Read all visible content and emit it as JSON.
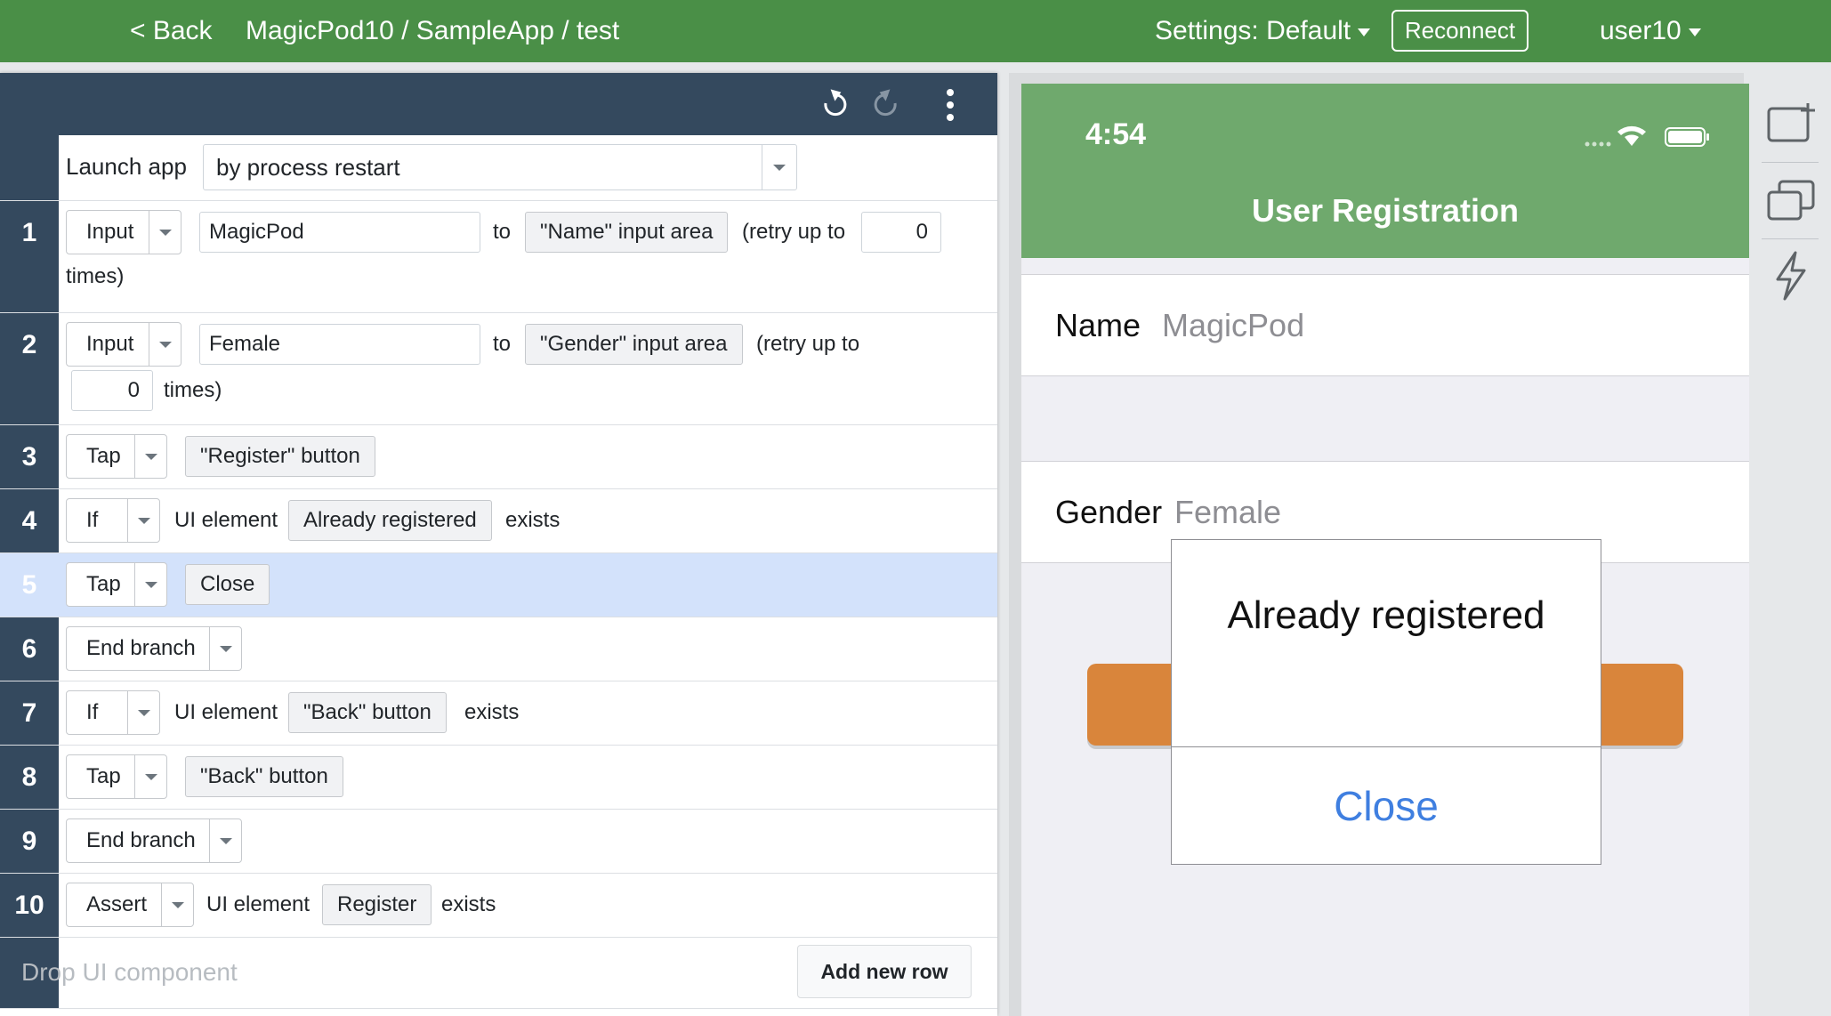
{
  "header": {
    "back_label": "< Back",
    "breadcrumb": "MagicPod10 / SampleApp / test",
    "settings_label": "Settings: Default",
    "reconnect_label": "Reconnect",
    "user_label": "user10"
  },
  "toolbar": {
    "icons": [
      "undo-icon",
      "redo-icon",
      "more-vertical-icon"
    ]
  },
  "launch": {
    "label": "Launch app",
    "value": "by process restart"
  },
  "steps": [
    {
      "num": "1",
      "command": "Input",
      "value": "MagicPod",
      "to": "to",
      "target": "\"Name\" input area",
      "retry_prefix": "(retry up to",
      "retry_count": "0",
      "retry_suffix": "times)"
    },
    {
      "num": "2",
      "command": "Input",
      "value": "Female",
      "to": "to",
      "target": "\"Gender\" input area",
      "retry_prefix": "(retry up to",
      "retry_count": "0",
      "retry_suffix": "times)"
    },
    {
      "num": "3",
      "command": "Tap",
      "target": "\"Register\" button"
    },
    {
      "num": "4",
      "command": "If",
      "prefix": "UI element",
      "target": "Already registered",
      "suffix": "exists"
    },
    {
      "num": "5",
      "command": "Tap",
      "target": "Close",
      "selected": true
    },
    {
      "num": "6",
      "command": "End branch"
    },
    {
      "num": "7",
      "command": "If",
      "prefix": "UI element",
      "target": "\"Back\" button",
      "suffix": "exists"
    },
    {
      "num": "8",
      "command": "Tap",
      "target": "\"Back\" button"
    },
    {
      "num": "9",
      "command": "End branch"
    },
    {
      "num": "10",
      "command": "Assert",
      "prefix": "UI element",
      "target": "Register",
      "suffix": "exists"
    }
  ],
  "footer": {
    "drop_placeholder": "Drop UI component",
    "add_row_label": "Add new row"
  },
  "device": {
    "time": "4:54",
    "title": "User Registration",
    "name_label": "Name",
    "name_value": "MagicPod",
    "gender_label": "Gender",
    "gender_value": "Female",
    "alert_title": "Already registered",
    "alert_button": "Close",
    "colors": {
      "navbar": "#6fa96d",
      "button": "#d9853b",
      "link": "#3f7fe0"
    }
  },
  "sidebar_tools": [
    "add-screen-icon",
    "screens-icon",
    "lightning-icon"
  ],
  "colors": {
    "header": "#4a8f47",
    "editor_dark": "#34495e",
    "selected_row": "#d3e2fb"
  }
}
